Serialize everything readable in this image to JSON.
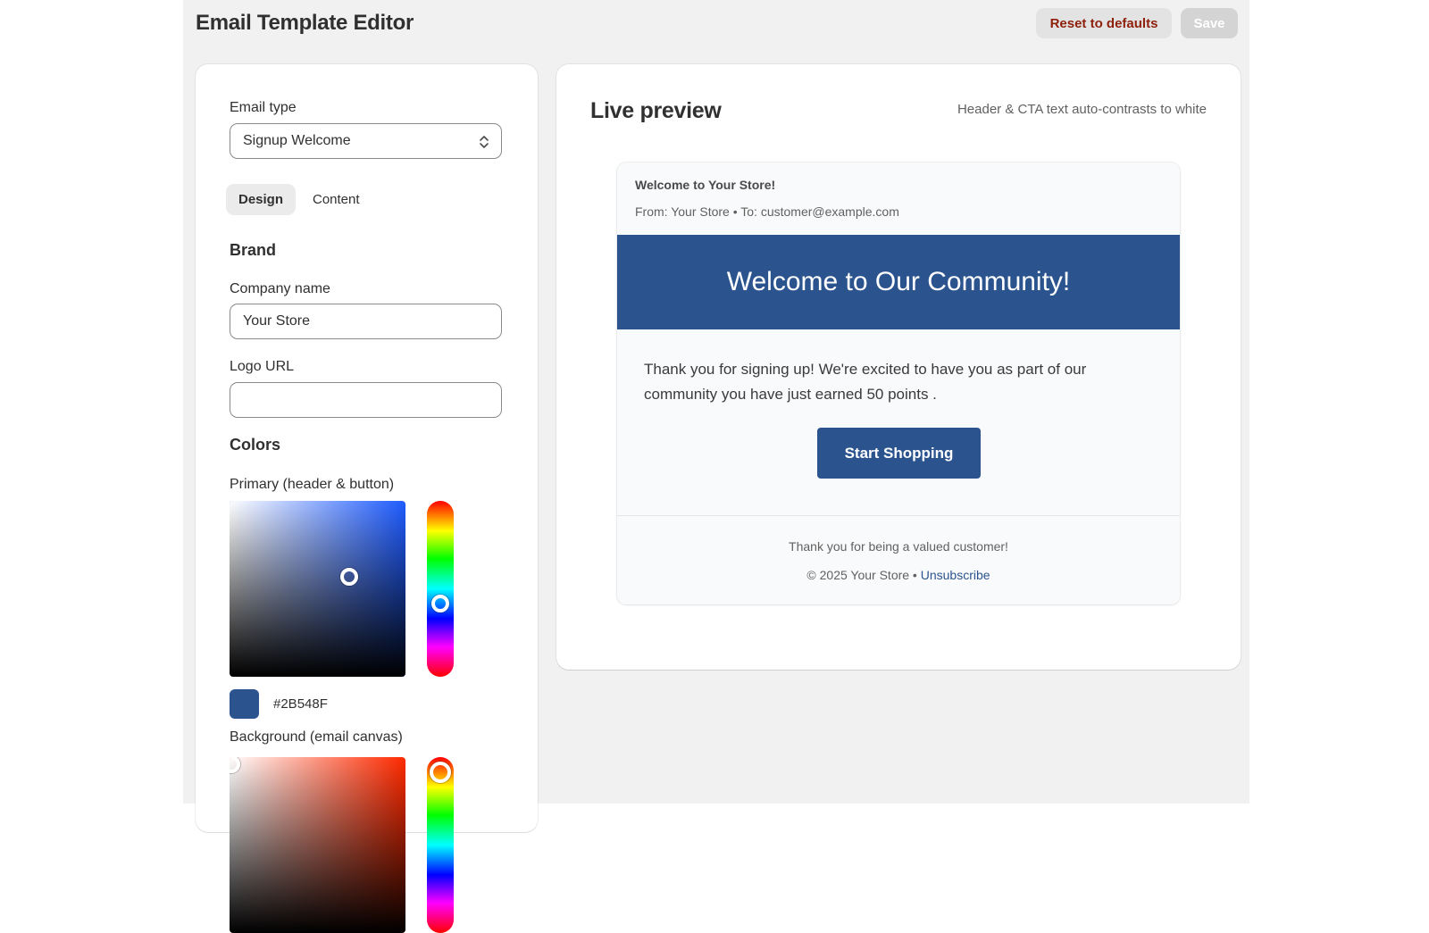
{
  "header": {
    "title": "Email Template Editor",
    "reset_label": "Reset to defaults",
    "save_label": "Save"
  },
  "settings": {
    "email_type_label": "Email type",
    "email_type_value": "Signup Welcome",
    "tabs": [
      {
        "label": "Design",
        "active": true
      },
      {
        "label": "Content",
        "active": false
      }
    ],
    "brand_heading": "Brand",
    "company_name_label": "Company name",
    "company_name_value": "Your Store",
    "logo_url_label": "Logo URL",
    "logo_url_value": "",
    "colors_heading": "Colors",
    "primary_label": "Primary (header & button)",
    "primary_hex": "#2B548F",
    "background_label": "Background (email canvas)"
  },
  "colors": {
    "primary": "#2B548F",
    "primary_hue_base": "#1f5cff",
    "background_hue_base": "#ff2a00"
  },
  "preview": {
    "title": "Live preview",
    "note": "Header & CTA text auto-contrasts to white",
    "subject": "Welcome to Your Store!",
    "from_line": "From: Your Store • To: customer@example.com",
    "header_text": "Welcome to Our Community!",
    "body_text": "Thank you for signing up! We're excited to have you as part of our community you have just earned 50 points .",
    "cta_label": "Start Shopping",
    "footer_thanks": "Thank you for being a valued customer!",
    "footer_copyright": "© 2025 Your Store • ",
    "unsubscribe_label": "Unsubscribe"
  }
}
